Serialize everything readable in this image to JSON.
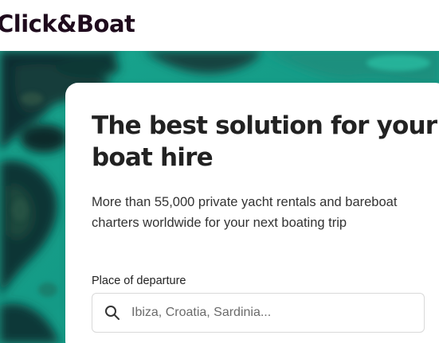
{
  "header": {
    "logo_text": "Click&Boat"
  },
  "hero": {
    "title": "The best solution for your boat hire",
    "subtitle": "More than 55,000 private yacht rentals and bareboat charters worldwide for your next boating trip",
    "search": {
      "label": "Place of departure",
      "placeholder": "Ibiza, Croatia, Sardinia...",
      "value": ""
    }
  },
  "colors": {
    "brand": "#1f0b1d",
    "sea_light": "#1fb39a",
    "sea_dark": "#0e3a3a"
  },
  "icons": {
    "search": "search-icon"
  }
}
